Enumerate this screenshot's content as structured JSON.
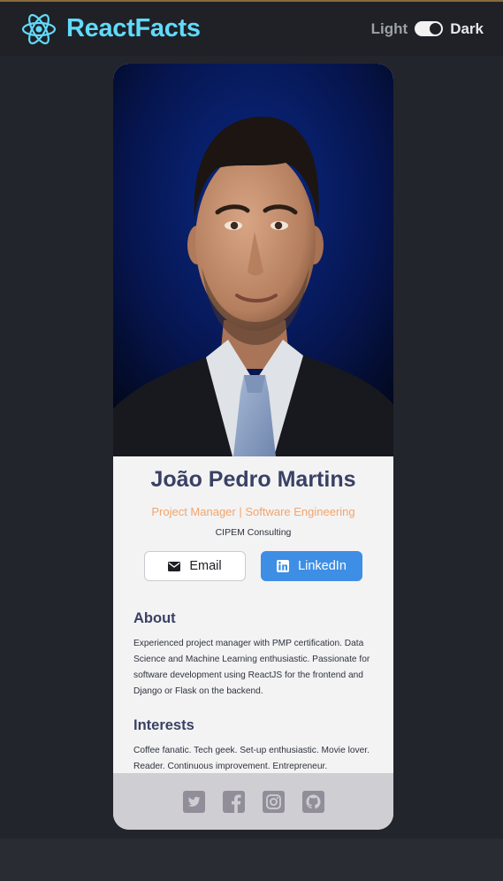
{
  "app": {
    "brand_name": "ReactFacts",
    "brand_icon": "react-atom-icon",
    "theme_toggle": {
      "light_label": "Light",
      "dark_label": "Dark",
      "dark_mode_on": true
    }
  },
  "profile": {
    "photo_alt": "Portrait of João Pedro Martins",
    "name": "João Pedro Martins",
    "title": "Project Manager | Software Engineering",
    "company": "CIPEM Consulting",
    "email_label": "Email",
    "linkedin_label": "LinkedIn",
    "about_heading": "About",
    "about_text": "Experienced project manager with PMP certification. Data Science and Machine Learning enthusiastic. Passionate for software development using ReactJS for the frontend and Django or Flask on the backend.",
    "interests_heading": "Interests",
    "interests_text": "Coffee fanatic. Tech geek. Set-up enthusiastic. Movie lover. Reader. Continuous improvement. Entrepreneur."
  },
  "social_icons": [
    "twitter-icon",
    "facebook-icon",
    "instagram-icon",
    "github-icon"
  ],
  "colors": {
    "background": "#23252c",
    "navbar": "#1f2126",
    "brand": "#61dafb",
    "card": "#f3f3f3",
    "name": "#3a4166",
    "title": "#f3a46b",
    "linkedin_button": "#3d8ee4",
    "footer": "#cfced3",
    "social_icon": "#918e99"
  }
}
